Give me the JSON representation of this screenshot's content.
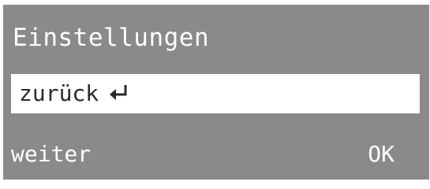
{
  "screen": {
    "title": "Einstellungen",
    "selected_item": {
      "label": "zurück",
      "icon": "return-arrow-icon"
    },
    "softkeys": {
      "left": "weiter",
      "right": "OK"
    },
    "colors": {
      "background": "#8a8a8a",
      "highlight": "#ffffff",
      "text": "#ffffff",
      "highlight_text": "#2a2a2a"
    }
  }
}
